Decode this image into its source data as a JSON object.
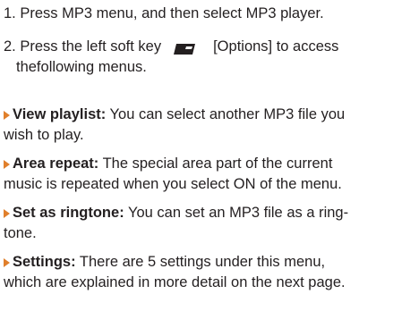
{
  "steps": [
    {
      "number": "1.",
      "text": "Press MP3 menu, and then select MP3 player."
    },
    {
      "number": "2.",
      "text_before": "Press the left soft key",
      "text_after": "[Options] to access",
      "continuation": "thefollowing menus.",
      "key_icon": "left-soft-key-icon"
    }
  ],
  "items": [
    {
      "term": "View playlist:",
      "line1": "You can select another MP3 file you",
      "line2": "wish to play."
    },
    {
      "term": "Area repeat:",
      "line1": "The special area part of the current",
      "line2": "music is repeated when you select ON of the menu."
    },
    {
      "term": "Set as ringtone:",
      "line1": "You can set an MP3 file as a ring-",
      "line2": "tone."
    },
    {
      "term": "Settings:",
      "line1": "There are 5 settings under this menu,",
      "line2": "which are explained in more detail on the next page."
    }
  ],
  "colors": {
    "text": "#231f20",
    "bullet": "#e07f2b",
    "key_icon": "#231f20"
  }
}
